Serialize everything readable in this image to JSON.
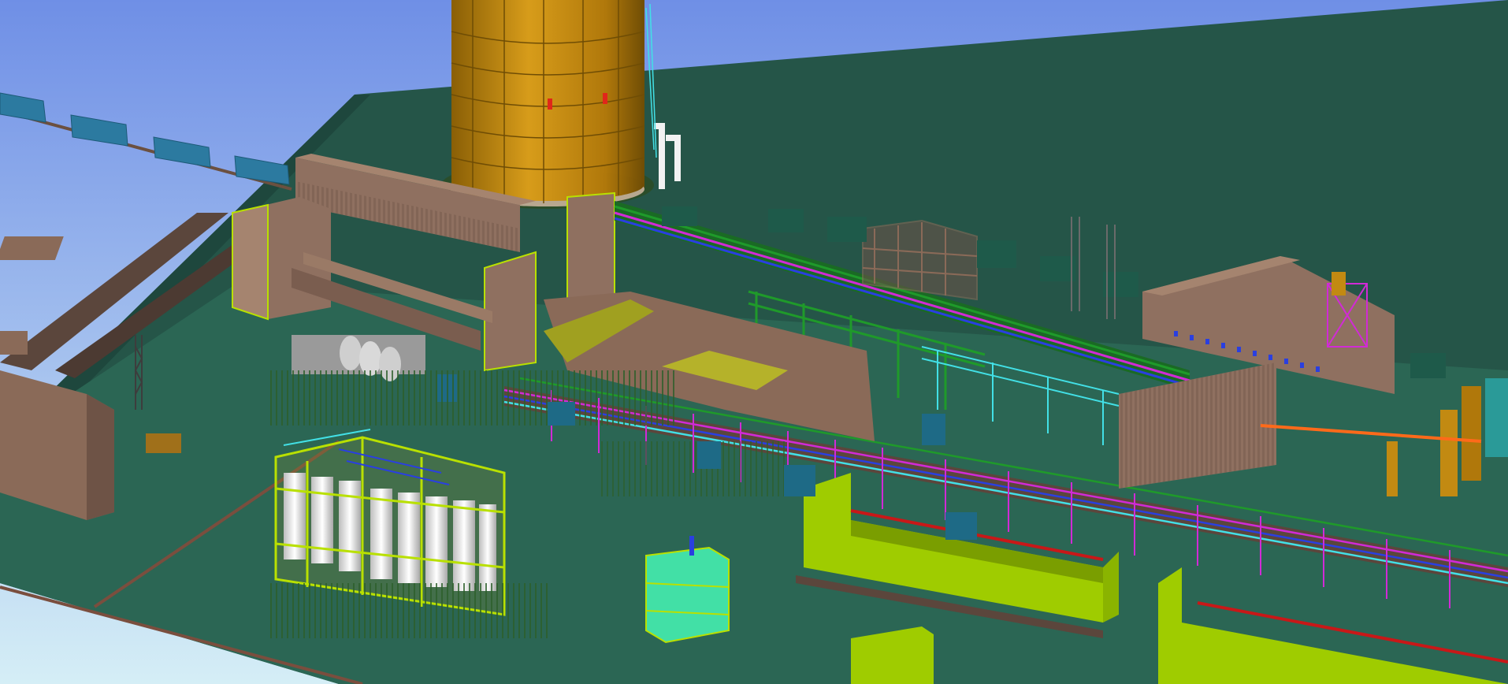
{
  "scene": {
    "kind": "3D plant model render",
    "labels": [],
    "palette": {
      "sky_top": "#6f8fe6",
      "sky_bottom": "#cfe8f4",
      "ground": "#255548",
      "ground_light": "#2f6a58",
      "concrete": "#8a6a58",
      "concrete_dark": "#5b463c",
      "building": "#8f7060",
      "tank": "#c28a12",
      "tank_dark": "#8a5f06",
      "steel_green": "#1f9a2a",
      "steel_magenta": "#d12ad6",
      "steel_blue": "#2a3fe0",
      "steel_cyan": "#42e0e6",
      "steel_yellowgreen": "#b9e000",
      "silo_white": "#f2f2f2",
      "teal_box": "#2a7f8c"
    },
    "elements": [
      "sky",
      "ground-plane",
      "conveyor-road",
      "storage-tank",
      "main-pipe-rack",
      "processing-building",
      "silo-structure",
      "basin-walls",
      "tower-structure",
      "railcars"
    ]
  }
}
